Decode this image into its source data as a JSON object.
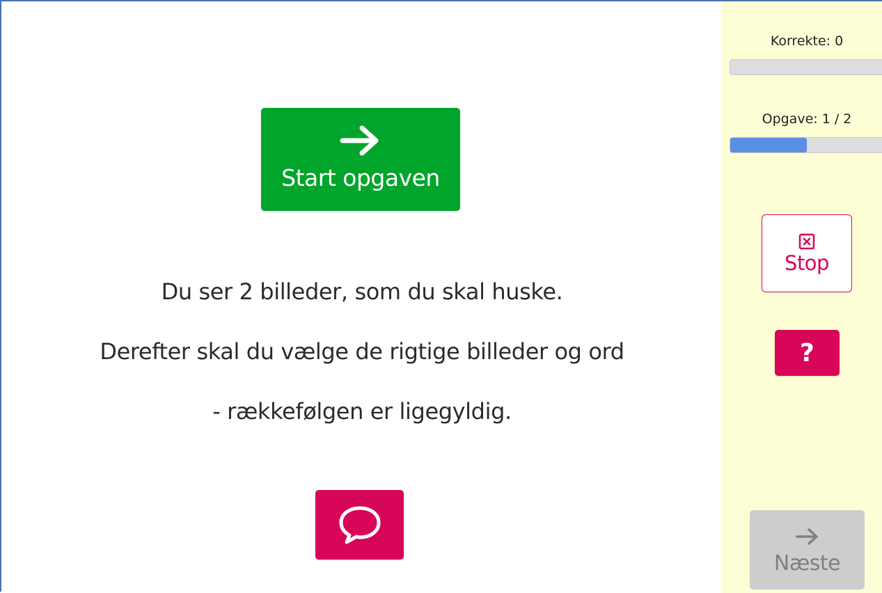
{
  "main": {
    "start_button": {
      "label": "Start opgaven",
      "icon": "arrow-right-icon"
    },
    "instructions": [
      "Du ser 2 billeder, som du skal huske.",
      "Derefter skal du vælge de rigtige billeder og ord",
      "- rækkefølgen er ligegyldig."
    ],
    "speech_button": {
      "icon": "speech-bubble-icon"
    }
  },
  "sidebar": {
    "correct_label": "Korrekte: 0",
    "correct_progress": 0,
    "task_label": "Opgave: 1 / 2",
    "task_progress": 0.5,
    "stop_button": {
      "label": "Stop",
      "icon": "close-box-icon"
    },
    "help_button": {
      "label": "?"
    },
    "next_button": {
      "label": "Næste",
      "icon": "arrow-right-icon",
      "disabled": true
    }
  },
  "colors": {
    "start_green": "#02a52c",
    "accent_pink": "#d80658",
    "sidebar_bg": "#fefed6",
    "progress_blue": "#5b8fe6",
    "disabled_grey": "#cdcdcd",
    "frame_border": "#4a72b0"
  }
}
